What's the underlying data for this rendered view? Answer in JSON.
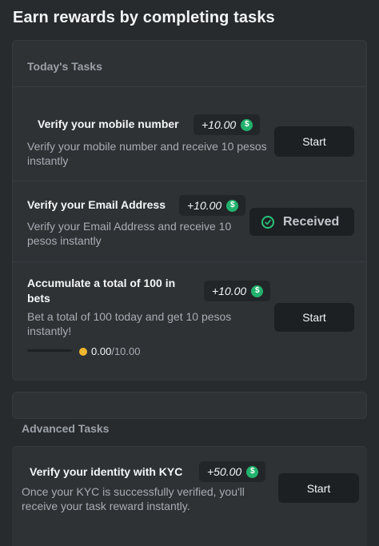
{
  "page": {
    "title": "Earn rewards by completing tasks"
  },
  "todays_tasks": {
    "header": "Today's Tasks",
    "tasks": [
      {
        "title": "Verify your mobile number",
        "reward": "+10.00",
        "coin_symbol": "$",
        "description": "Verify your mobile number and receive 10 pesos instantly",
        "action": "Start",
        "status": "start"
      },
      {
        "title": "Verify your Email Address",
        "reward": "+10.00",
        "coin_symbol": "$",
        "description": "Verify your Email Address and receive 10 pesos instantly",
        "action": "Received",
        "status": "received"
      },
      {
        "title": "Accumulate a total of 100 in bets",
        "reward": "+10.00",
        "coin_symbol": "$",
        "description": "Bet a total of 100 today and get 10 pesos instantly!",
        "action": "Start",
        "status": "start",
        "progress": {
          "current": "0.00",
          "separator": "/",
          "target": "10.00",
          "fraction": 0
        }
      }
    ]
  },
  "advanced_tasks": {
    "header": "Advanced Tasks",
    "tasks": [
      {
        "title": "Verify your identity with KYC",
        "reward": "+50.00",
        "coin_symbol": "$",
        "description": "Once your KYC is successfully verified, you'll receive your task reward instantly.",
        "action": "Start",
        "status": "start"
      }
    ]
  },
  "colors": {
    "background": "#282b2e",
    "card": "#2f3235",
    "button": "#1d2023",
    "coin": "#23b26d",
    "check": "#2bc37a",
    "progress_dot": "#f0b72e"
  },
  "icons": {
    "coin": "dollar-coin-icon",
    "received": "check-circle-icon",
    "progress": "gold-coin-icon"
  }
}
